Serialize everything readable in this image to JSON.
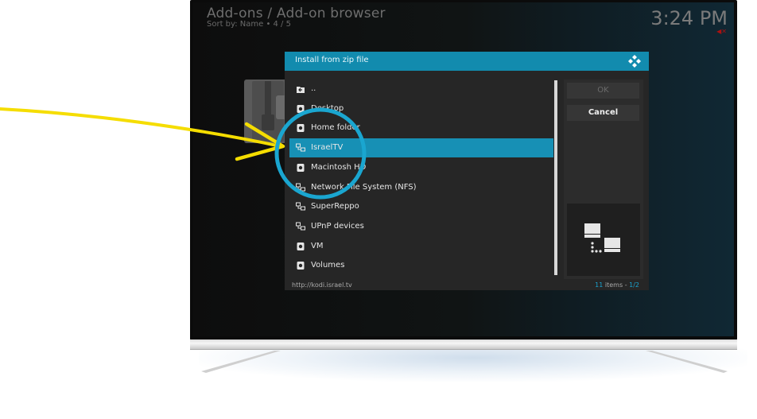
{
  "kodi": {
    "title": "Add-ons / Add-on browser",
    "subtitle": "Sort by: Name  •  4 / 5",
    "clock": "3:24 PM"
  },
  "dialog": {
    "title": "Install from zip file",
    "items": [
      {
        "label": "..",
        "icon": "folder-up-icon",
        "selected": false
      },
      {
        "label": "Desktop",
        "icon": "drive-icon",
        "selected": false
      },
      {
        "label": "Home folder",
        "icon": "drive-icon",
        "selected": false
      },
      {
        "label": "IsraelTV",
        "icon": "network-share-icon",
        "selected": true
      },
      {
        "label": "Macintosh HD",
        "icon": "drive-icon",
        "selected": false
      },
      {
        "label": "Network File System (NFS)",
        "icon": "network-share-icon",
        "selected": false
      },
      {
        "label": "SuperReppo",
        "icon": "network-share-icon",
        "selected": false
      },
      {
        "label": "UPnP devices",
        "icon": "network-share-icon",
        "selected": false
      },
      {
        "label": "VM",
        "icon": "drive-icon",
        "selected": false
      },
      {
        "label": "Volumes",
        "icon": "drive-icon",
        "selected": false
      }
    ],
    "ok_label": "OK",
    "cancel_label": "Cancel",
    "path": "http://kodi.israel.tv",
    "count_number": "11",
    "count_suffix": " items - ",
    "page": "1/2"
  },
  "colors": {
    "accent": "#128bae",
    "selected": "#1790b5",
    "annotation_arrow": "#f5dd00",
    "annotation_circle": "#1aa6d0"
  }
}
